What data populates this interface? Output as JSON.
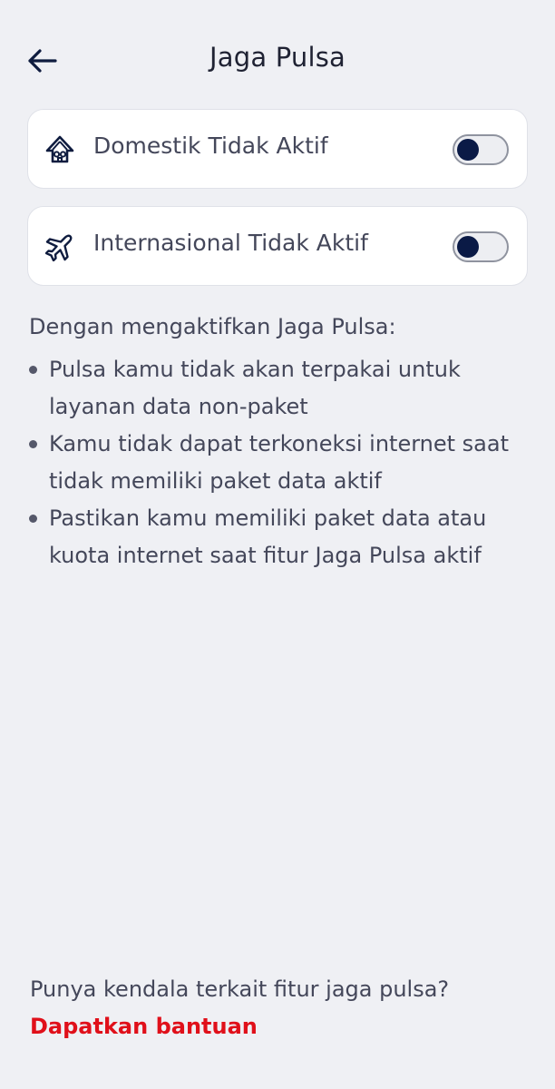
{
  "header": {
    "title": "Jaga Pulsa",
    "back_icon": "arrow-left-icon"
  },
  "cards": [
    {
      "id": "domestic",
      "icon": "gapura-icon",
      "label": "Domestik Tidak Aktif",
      "enabled": false
    },
    {
      "id": "international",
      "icon": "airplane-icon",
      "label": "Internasional Tidak Aktif",
      "enabled": false
    }
  ],
  "info": {
    "intro": "Dengan mengaktifkan Jaga Pulsa:",
    "items": [
      "Pulsa kamu tidak akan terpakai untuk layanan data non-paket",
      "Kamu tidak dapat terkoneksi internet saat tidak memiliki paket data aktif",
      "Pastikan kamu memiliki paket data atau kuota internet saat fitur Jaga Pulsa aktif"
    ]
  },
  "footer": {
    "question": "Punya kendala terkait fitur jaga pulsa?",
    "help_link": "Dapatkan bantuan"
  },
  "colors": {
    "background": "#eff0f4",
    "accent_red": "#e0101a",
    "toggle_knob": "#0a1a46",
    "text": "#44475a"
  }
}
